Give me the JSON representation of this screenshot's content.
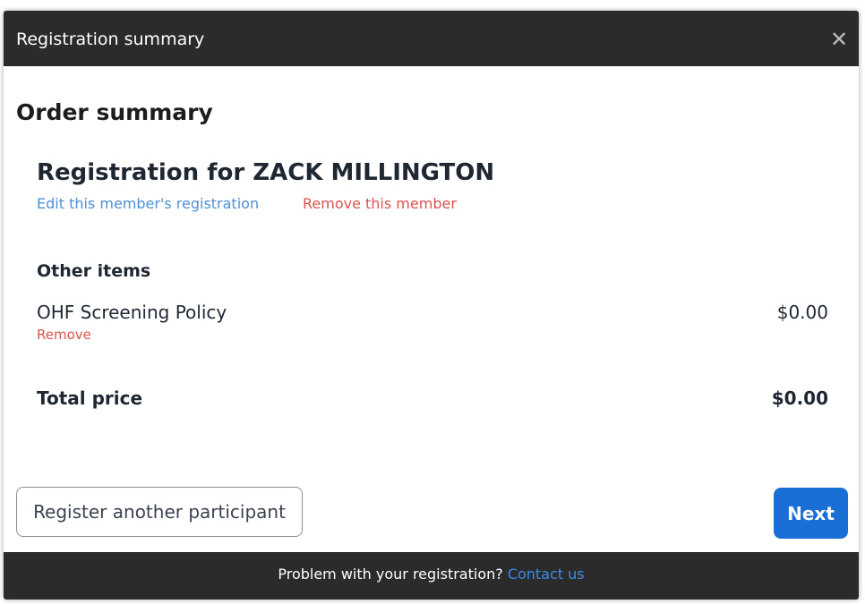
{
  "header": {
    "title": "Registration summary",
    "close_icon": "close-icon"
  },
  "order": {
    "title": "Order summary",
    "registration_title": "Registration for ZACK MILLINGTON",
    "edit_link": "Edit this member's registration",
    "remove_member_link": "Remove this member"
  },
  "other_items": {
    "heading": "Other items",
    "items": [
      {
        "name": "OHF Screening Policy",
        "price": "$0.00",
        "remove_label": "Remove"
      }
    ]
  },
  "total": {
    "label": "Total price",
    "value": "$0.00"
  },
  "actions": {
    "register_another": "Register another participant",
    "next": "Next"
  },
  "footer": {
    "text": "Problem with your registration? ",
    "link": "Contact us"
  },
  "colors": {
    "header_bg": "#2b2b2b",
    "link_blue": "#4e8fd6",
    "danger_red": "#d9534f",
    "primary_blue": "#1a6fd6"
  }
}
